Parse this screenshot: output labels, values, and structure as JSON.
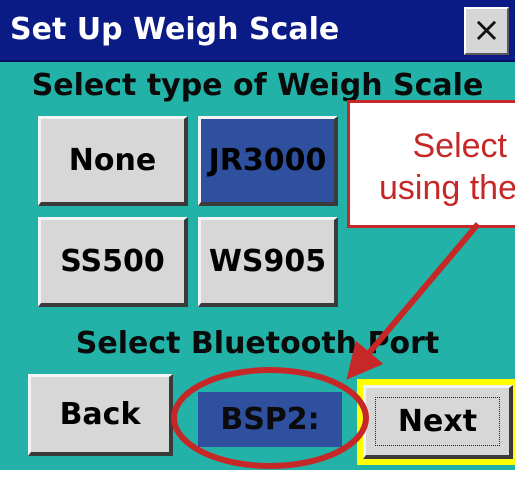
{
  "window": {
    "title": "Set Up Weigh Scale",
    "close_label": "×"
  },
  "scale_section": {
    "heading": "Select type of Weigh Scale",
    "options": [
      {
        "label": "None",
        "selected": false
      },
      {
        "label": "JR3000",
        "selected": true
      },
      {
        "label": "SS500",
        "selected": false
      },
      {
        "label": "WS905",
        "selected": false
      }
    ]
  },
  "port_section": {
    "heading": "Select Bluetooth Port",
    "value": "BSP2:"
  },
  "navigation": {
    "back_label": "Back",
    "next_label": "Next"
  },
  "annotation": {
    "line1": "Select",
    "line2": "using the",
    "color": "#c62828"
  },
  "colors": {
    "background": "#23b2a8",
    "titlebar": "#0a1b86",
    "selected": "#2f4f9f",
    "highlight": "#ffff00"
  }
}
